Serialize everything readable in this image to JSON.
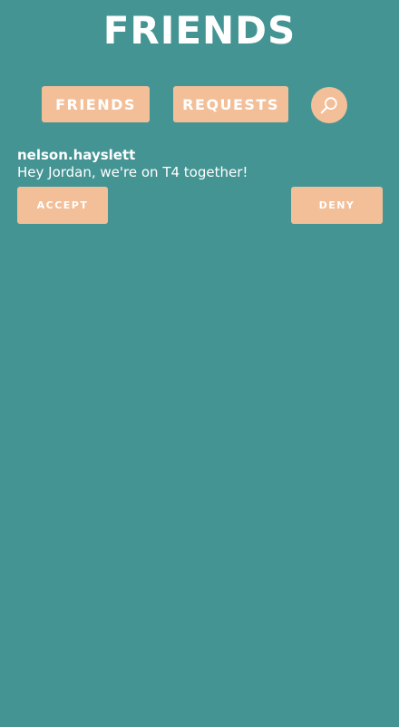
{
  "header": {
    "title": "FRIENDS"
  },
  "nav": {
    "friends_label": "FRIENDS",
    "requests_label": "REQUESTS",
    "search_icon": "search-icon"
  },
  "requests": [
    {
      "username": "nelson.hayslett",
      "message": "Hey Jordan, we're on T4 together!",
      "accept_label": "ACCEPT",
      "deny_label": "DENY"
    }
  ],
  "colors": {
    "background": "#459494",
    "accent": "#f3bf98",
    "text": "#ffffff"
  }
}
